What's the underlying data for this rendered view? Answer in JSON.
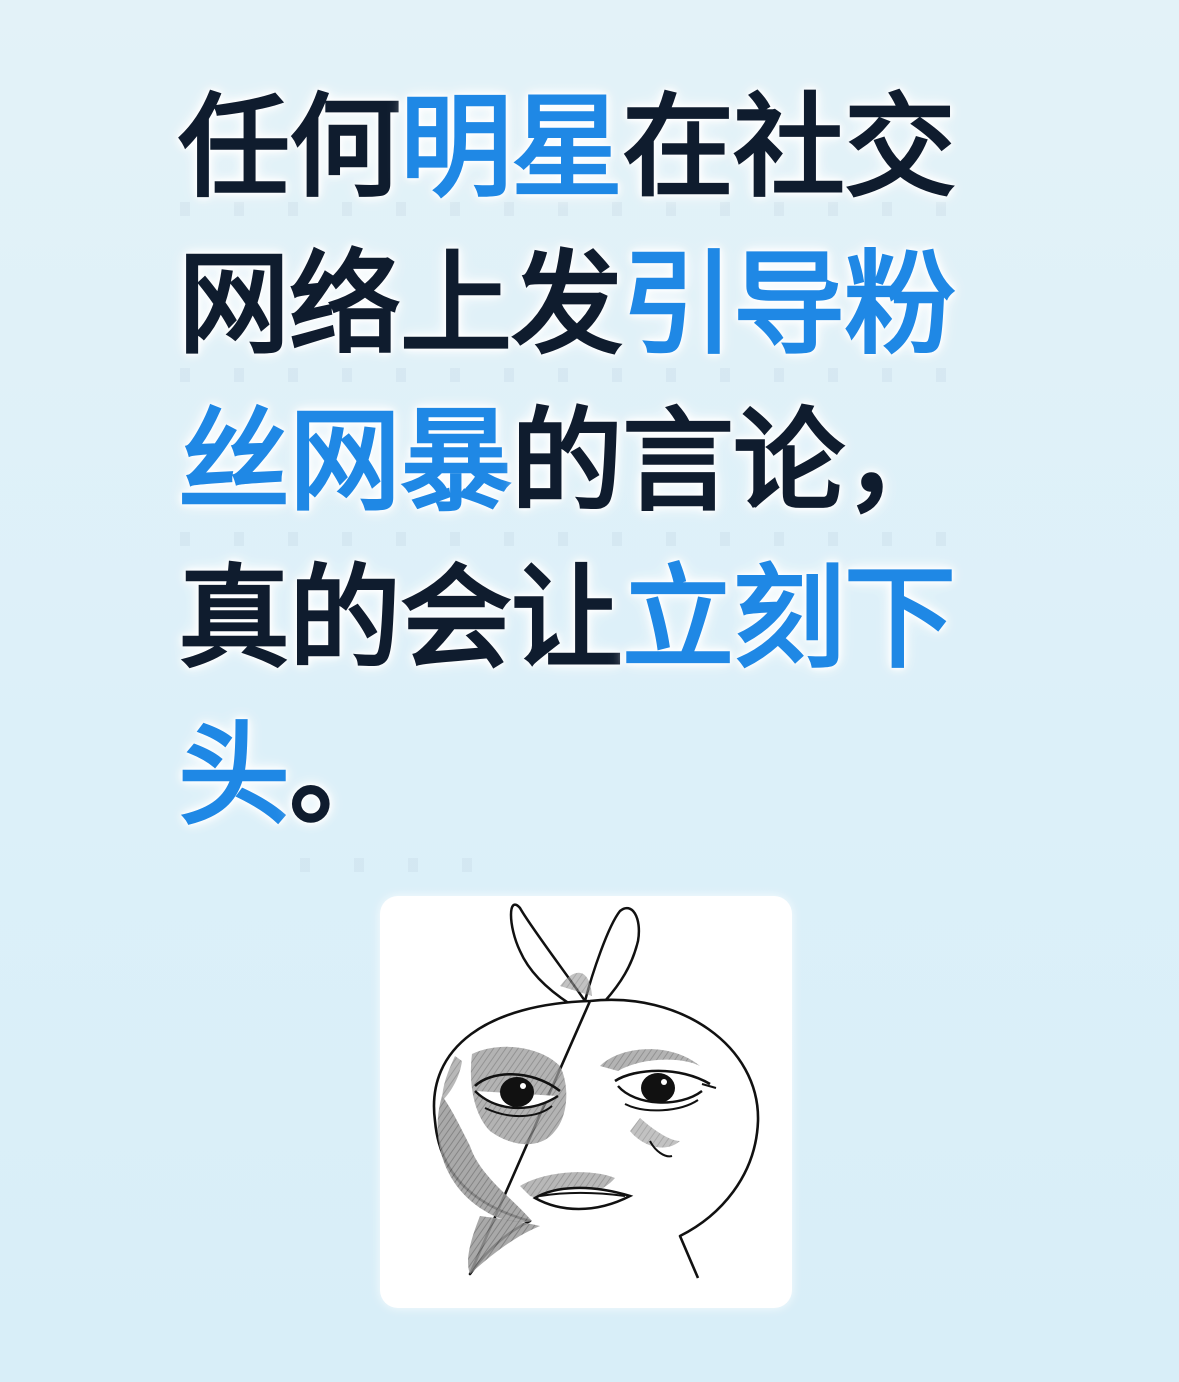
{
  "headline": {
    "line1": {
      "t1": "任何",
      "h1": "明星",
      "t2": "在社交"
    },
    "line2": {
      "t1": "网络上发",
      "h1": "引导粉"
    },
    "line3": {
      "h1": "丝网暴",
      "t1": "的言论，"
    },
    "line4": {
      "t1": "真的会让",
      "h1": "立刻下"
    },
    "line5": {
      "h1": "头",
      "t1": "。"
    }
  },
  "colors": {
    "text": "#0f1c2e",
    "highlight": "#1f88e5",
    "background": "#dcf0f9"
  },
  "sticker": {
    "icon": "bunny-meme-icon"
  }
}
